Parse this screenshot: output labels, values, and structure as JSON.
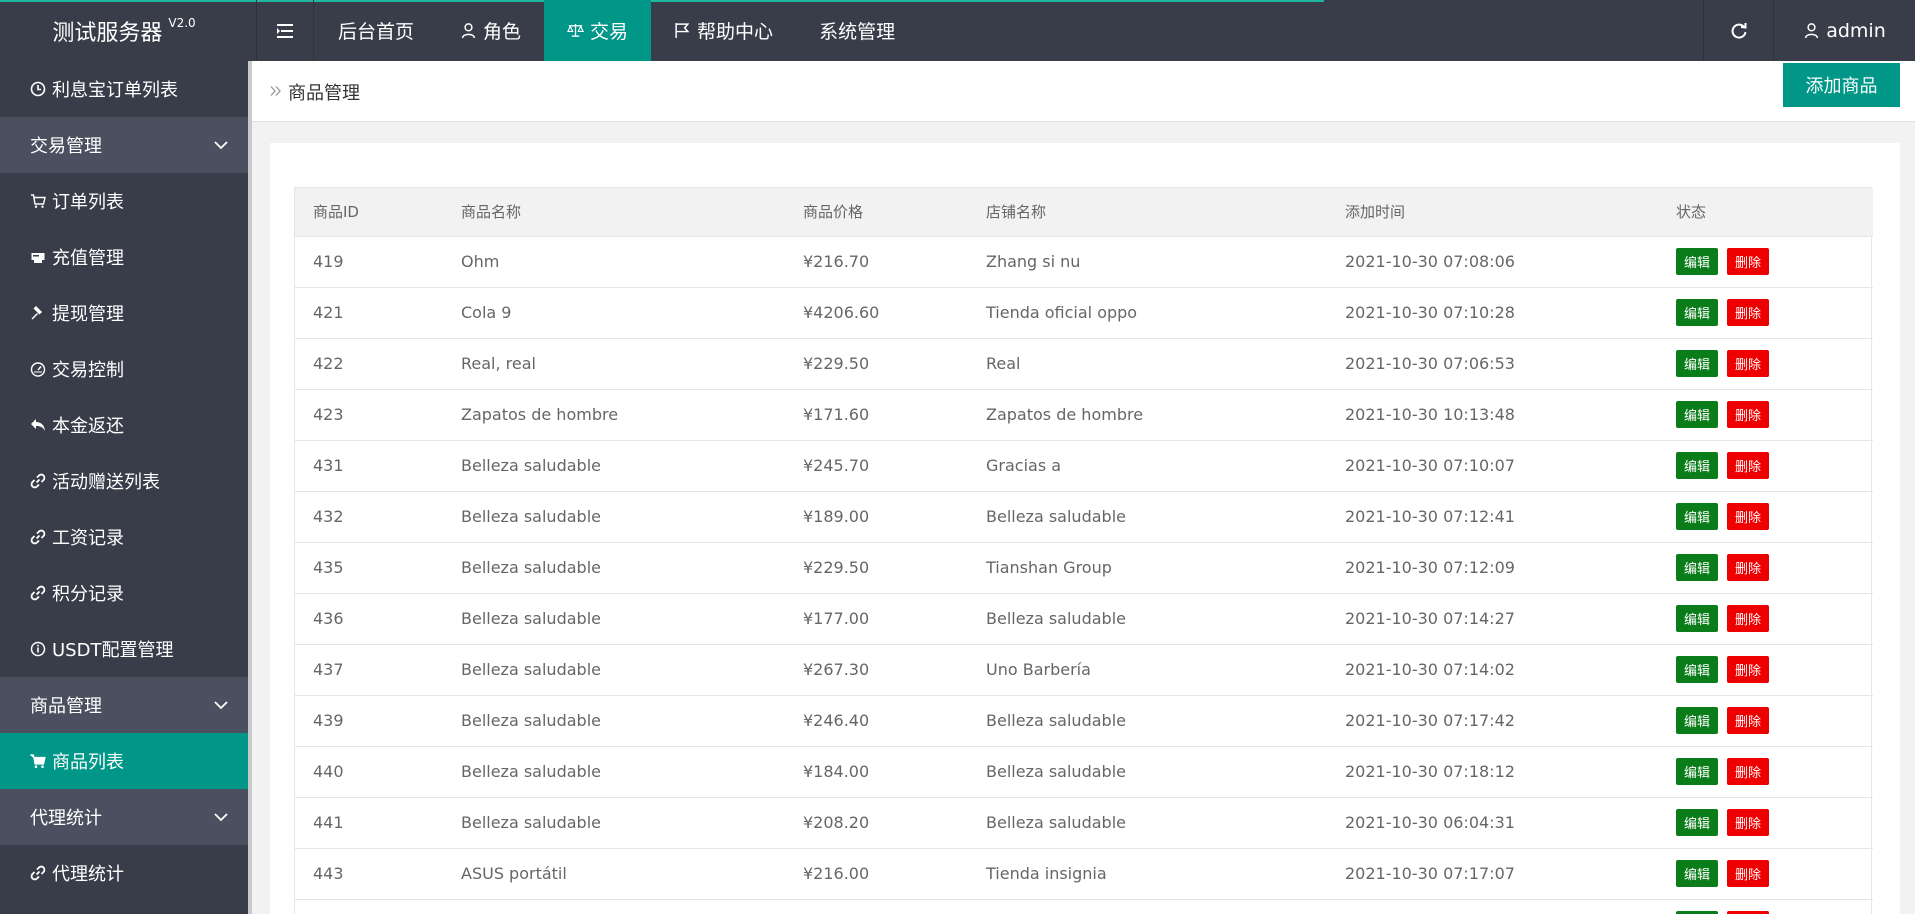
{
  "app": {
    "title": "测试服务器",
    "version": "V2.0"
  },
  "header": {
    "toggle_icon": "menu-toggle-icon",
    "nav": [
      {
        "label": "后台首页",
        "icon": ""
      },
      {
        "label": "角色",
        "icon": "user-icon"
      },
      {
        "label": "交易",
        "icon": "scale-icon",
        "active": true
      },
      {
        "label": "帮助中心",
        "icon": "flag-icon"
      },
      {
        "label": "系统管理",
        "icon": ""
      }
    ],
    "refresh_icon": "refresh-icon",
    "user": "admin"
  },
  "sidebar": {
    "items": [
      {
        "label": "利息宝订单列表",
        "icon": "clock-icon",
        "type": "item"
      },
      {
        "label": "交易管理",
        "type": "group"
      },
      {
        "label": "订单列表",
        "icon": "cart-icon",
        "type": "item"
      },
      {
        "label": "充值管理",
        "icon": "card-icon",
        "type": "item"
      },
      {
        "label": "提现管理",
        "icon": "hammer-icon",
        "type": "item"
      },
      {
        "label": "交易控制",
        "icon": "gauge-icon",
        "type": "item"
      },
      {
        "label": "本金返还",
        "icon": "reply-icon",
        "type": "item"
      },
      {
        "label": "活动赠送列表",
        "icon": "link-icon",
        "type": "item"
      },
      {
        "label": "工资记录",
        "icon": "link-icon",
        "type": "item"
      },
      {
        "label": "积分记录",
        "icon": "link-icon",
        "type": "item"
      },
      {
        "label": "USDT配置管理",
        "icon": "info-icon",
        "type": "item"
      },
      {
        "label": "商品管理",
        "type": "group"
      },
      {
        "label": "商品列表",
        "icon": "cart-icon",
        "type": "item",
        "selected": true
      },
      {
        "label": "代理统计",
        "type": "group"
      },
      {
        "label": "代理统计",
        "icon": "link-icon",
        "type": "item"
      }
    ]
  },
  "breadcrumb": {
    "label": "商品管理"
  },
  "actions": {
    "add_label": "添加商品"
  },
  "table": {
    "columns": [
      "商品ID",
      "商品名称",
      "商品价格",
      "店铺名称",
      "添加时间",
      "状态"
    ],
    "edit_label": "编辑",
    "delete_label": "删除",
    "rows": [
      [
        "419",
        "Ohm",
        "¥216.70",
        "Zhang si nu",
        "2021-10-30 07:08:06"
      ],
      [
        "421",
        "Cola 9",
        "¥4206.60",
        "Tienda oficial oppo",
        "2021-10-30 07:10:28"
      ],
      [
        "422",
        "Real, real",
        "¥229.50",
        "Real",
        "2021-10-30 07:06:53"
      ],
      [
        "423",
        "Zapatos de hombre",
        "¥171.60",
        "Zapatos de hombre",
        "2021-10-30 10:13:48"
      ],
      [
        "431",
        "Belleza saludable",
        "¥245.70",
        "Gracias a",
        "2021-10-30 07:10:07"
      ],
      [
        "432",
        "Belleza saludable",
        "¥189.00",
        "Belleza saludable",
        "2021-10-30 07:12:41"
      ],
      [
        "435",
        "Belleza saludable",
        "¥229.50",
        "Tianshan Group",
        "2021-10-30 07:12:09"
      ],
      [
        "436",
        "Belleza saludable",
        "¥177.00",
        "Belleza saludable",
        "2021-10-30 07:14:27"
      ],
      [
        "437",
        "Belleza saludable",
        "¥267.30",
        "Uno Barbería",
        "2021-10-30 07:14:02"
      ],
      [
        "439",
        "Belleza saludable",
        "¥246.40",
        "Belleza saludable",
        "2021-10-30 07:17:42"
      ],
      [
        "440",
        "Belleza saludable",
        "¥184.00",
        "Belleza saludable",
        "2021-10-30 07:18:12"
      ],
      [
        "441",
        "Belleza saludable",
        "¥208.20",
        "Belleza saludable",
        "2021-10-30 06:04:31"
      ],
      [
        "443",
        "ASUS portátil",
        "¥216.00",
        "Tienda insignia",
        "2021-10-30 07:17:07"
      ],
      [
        "",
        "",
        "",
        "",
        ""
      ]
    ]
  },
  "colors": {
    "header_bg": "#393d49",
    "accent": "#009688",
    "edit_btn": "#0b7c1a",
    "delete_btn": "#ee0000"
  }
}
